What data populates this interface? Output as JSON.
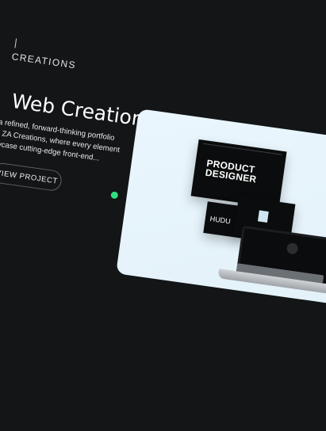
{
  "brand": {
    "name": "CREATIONS"
  },
  "hero": {
    "title": "Web Creation",
    "description_lines": [
      "on is a refined, forward-thinking portfolio",
      "resent ZA Creations, where every element",
      "o showcase cutting-edge front-end..."
    ],
    "cta_label": "VIEW PROJECT"
  },
  "preview": {
    "headline_line1": "PRODUCT",
    "headline_line2": "DESIGNER",
    "tag": "HUDU"
  },
  "colors": {
    "background": "#131517",
    "status_dot": "#2fe07f",
    "card_background": "#e8f5fc"
  }
}
